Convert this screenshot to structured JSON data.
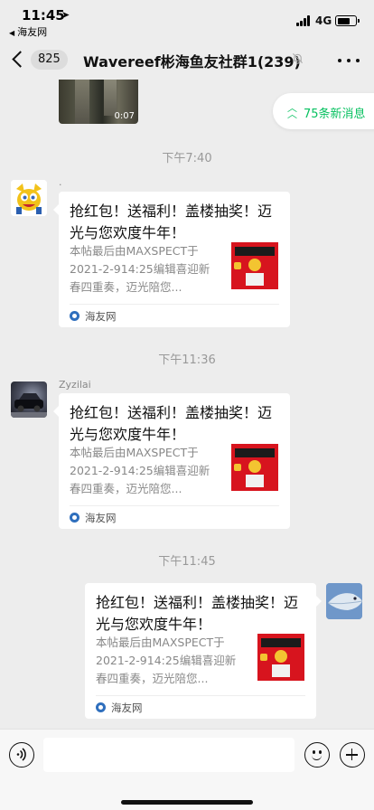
{
  "status_bar": {
    "time": "11:45",
    "back_app": "海友网",
    "network": "4G"
  },
  "nav": {
    "unread_count": "825",
    "title": "Wavereef彬海鱼友社群1(239)",
    "icons": {
      "back": "chevron-left-icon",
      "mute": "bell-off-icon",
      "more": "more-dots-icon"
    }
  },
  "colors": {
    "accent_green": "#07c160",
    "background": "#ededed",
    "bubble": "#ffffff"
  },
  "chat": {
    "video": {
      "duration": "0:07"
    },
    "new_messages_label": "75条新消息",
    "messages": [
      {
        "time": "下午7:40",
        "sender": "·",
        "side": "left",
        "card": {
          "title": "抢红包！送福利！盖楼抽奖！迈光与您欢度牛年！",
          "desc": "本帖最后由MAXSPECT于2021-2-914:25编辑喜迎新春四重奏，迈光陪您...",
          "source": "海友网"
        }
      },
      {
        "time": "下午11:36",
        "sender": "Zyzilai",
        "side": "left",
        "card": {
          "title": "抢红包！送福利！盖楼抽奖！迈光与您欢度牛年！",
          "desc": "本帖最后由MAXSPECT于2021-2-914:25编辑喜迎新春四重奏，迈光陪您...",
          "source": "海友网"
        }
      },
      {
        "time": "下午11:45",
        "sender": "",
        "side": "right",
        "card": {
          "title": "抢红包！送福利！盖楼抽奖！迈光与您欢度牛年！",
          "desc": "本帖最后由MAXSPECT于2021-2-914:25编辑喜迎新春四重奏，迈光陪您...",
          "source": "海友网"
        }
      }
    ]
  },
  "input": {
    "placeholder": "",
    "value": ""
  }
}
